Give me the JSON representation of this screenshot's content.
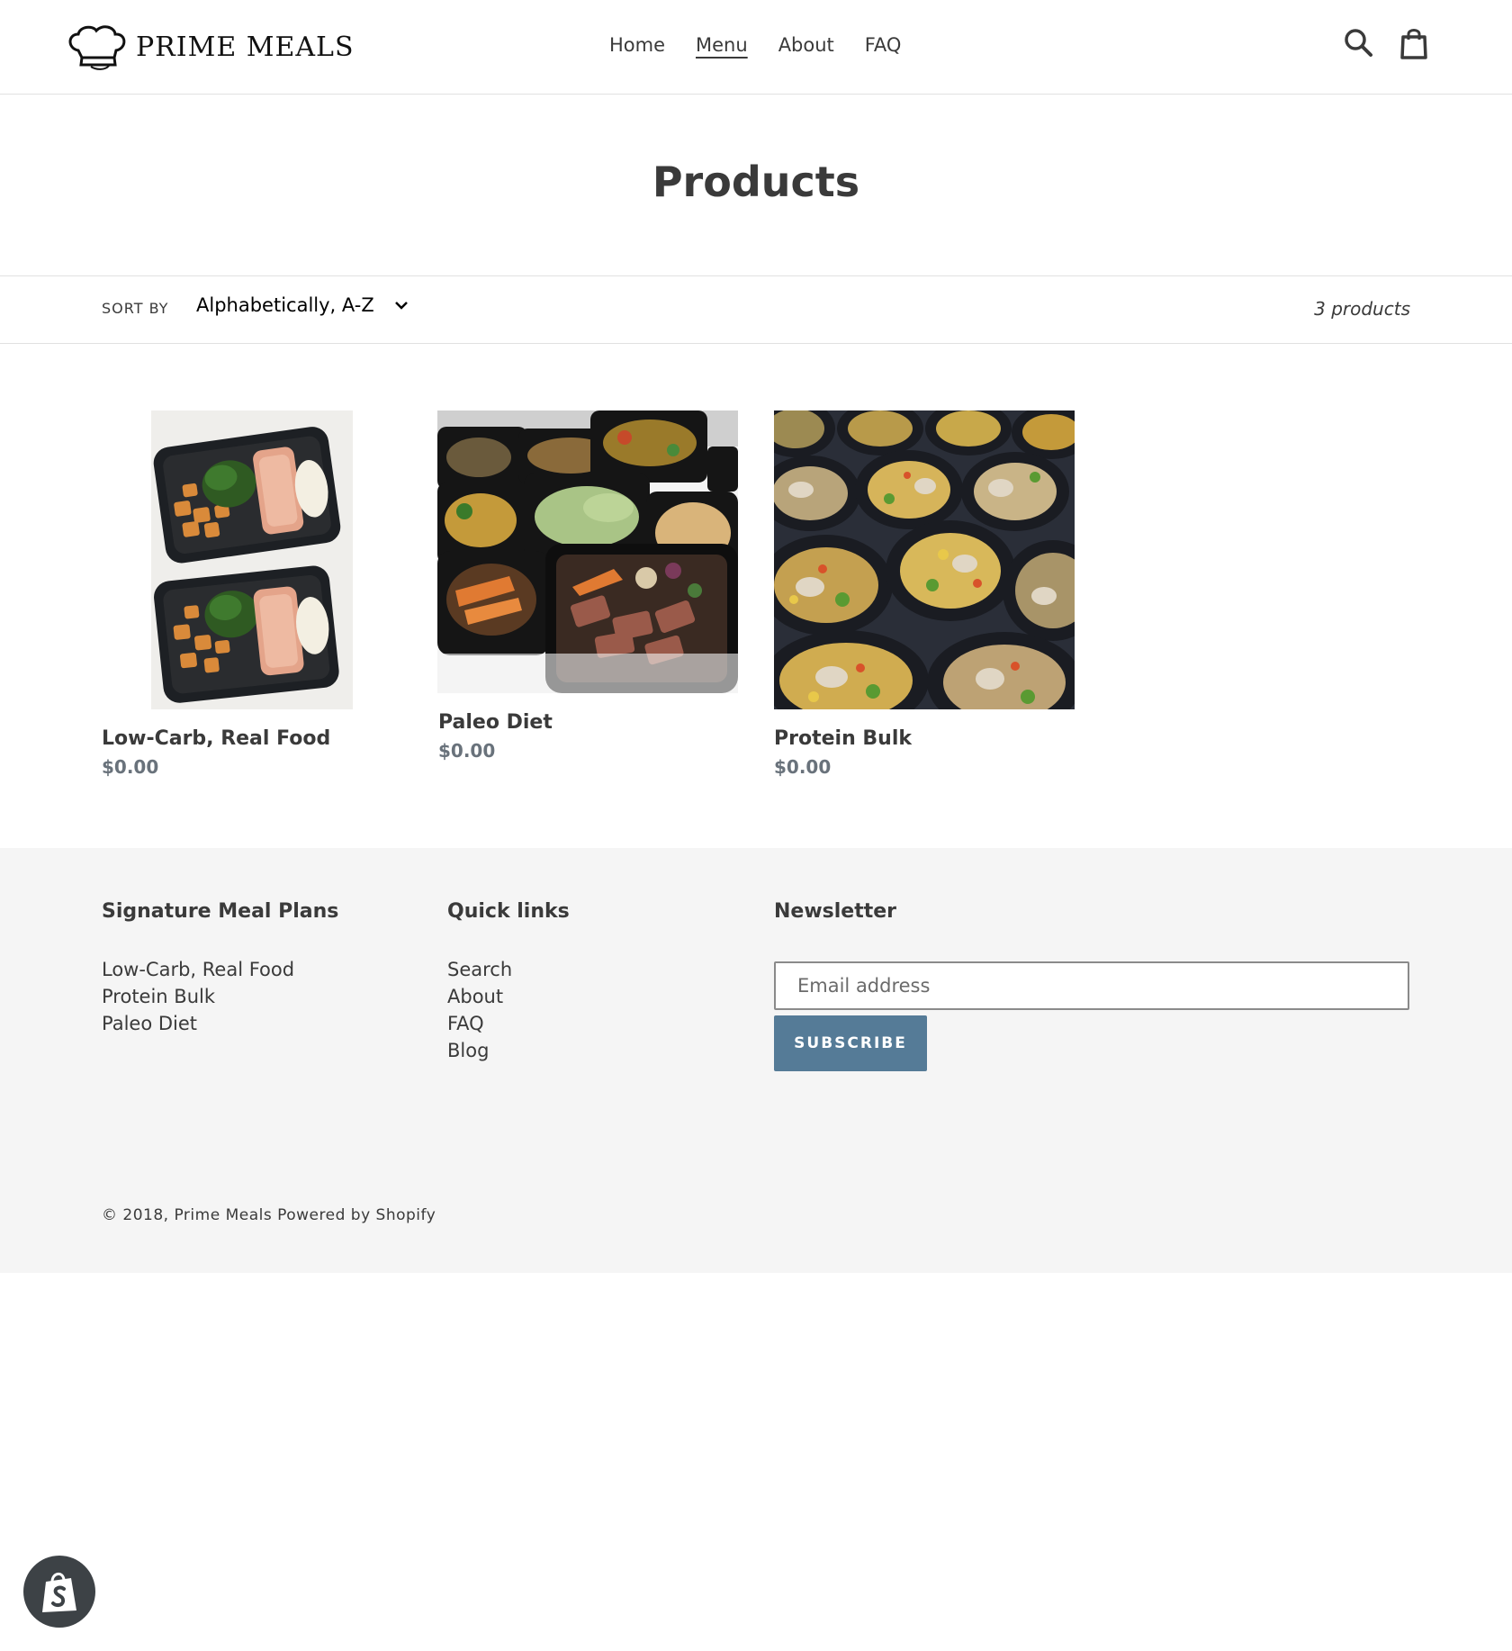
{
  "header": {
    "brand": "PRIME MEALS",
    "nav": [
      {
        "label": "Home",
        "active": false
      },
      {
        "label": "Menu",
        "active": true
      },
      {
        "label": "About",
        "active": false
      },
      {
        "label": "FAQ",
        "active": false
      }
    ],
    "icons": [
      "search-icon",
      "cart-icon"
    ]
  },
  "page": {
    "title": "Products"
  },
  "filters": {
    "sort_label": "Sort by",
    "sort_value": "Alphabetically, A-Z",
    "count": "3 products"
  },
  "products": [
    {
      "title": "Low-Carb, Real Food",
      "price": "$0.00"
    },
    {
      "title": "Paleo Diet",
      "price": "$0.00"
    },
    {
      "title": "Protein Bulk",
      "price": "$0.00"
    }
  ],
  "footer": {
    "col1": {
      "heading": "Signature Meal Plans",
      "links": [
        "Low-Carb, Real Food",
        "Protein Bulk",
        "Paleo Diet"
      ]
    },
    "col2": {
      "heading": "Quick links",
      "links": [
        "Search",
        "About",
        "FAQ",
        "Blog"
      ]
    },
    "newsletter": {
      "heading": "Newsletter",
      "placeholder": "Email address",
      "button": "SUBSCRIBE"
    },
    "copyright_prefix": "© 2018,",
    "copyright_brand": "Prime Meals",
    "powered_by": "Powered by Shopify"
  },
  "colors": {
    "accent": "#557b97",
    "text": "#3a3a3a",
    "price": "#69727b",
    "footer_bg": "#f5f5f5",
    "badge": "#3d4246"
  }
}
